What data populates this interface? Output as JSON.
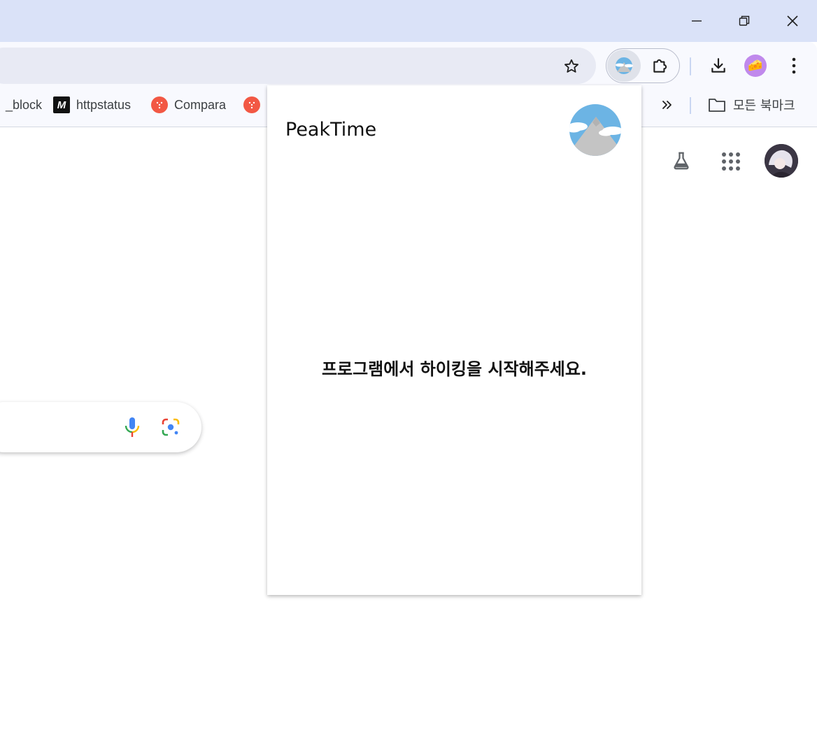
{
  "bookmarks": {
    "items": [
      {
        "label": "_block",
        "icon": "none"
      },
      {
        "label": "httpstatus",
        "icon": "httpstatus-favicon"
      },
      {
        "label": "Compara",
        "icon": "compara-favicon"
      },
      {
        "label": "",
        "icon": "compara-favicon"
      }
    ],
    "all_bookmarks_label": "모든 북마크"
  },
  "extension_popup": {
    "title": "PeakTime",
    "message": "프로그램에서 하이킹을 시작해주세요."
  },
  "colors": {
    "titlebar": "#dae2f8",
    "toolbar": "#f8f9fe",
    "omnibox": "#e8eaf4",
    "profile": "#c089ec",
    "favicon_red": "#f25844",
    "logo_sky": "#6cb4e4",
    "logo_mountain": "#c4c4c4"
  }
}
